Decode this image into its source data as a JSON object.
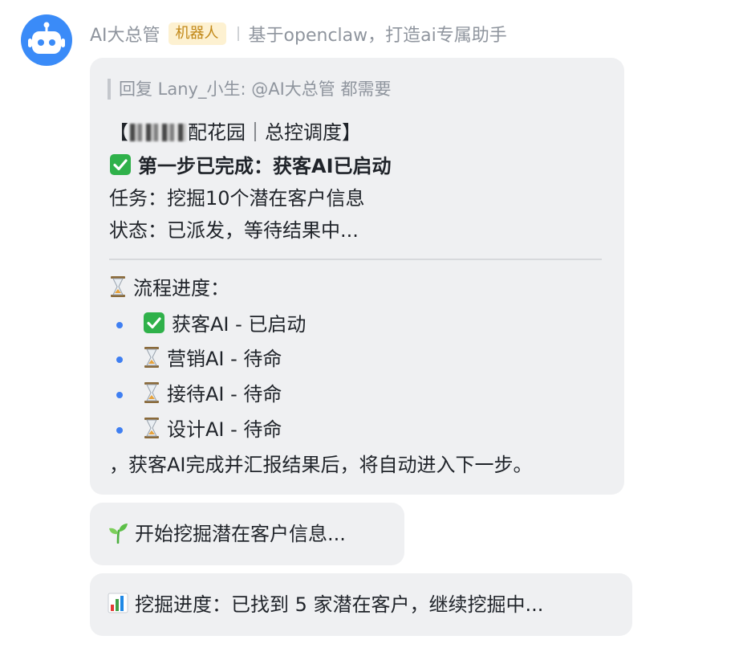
{
  "sender": {
    "name": "AI大总管",
    "tag": "机器人",
    "description": "基于openclaw，打造ai专属助手"
  },
  "main_message": {
    "reply_to": "回复 Lany_小生: @AI大总管 都需要",
    "title_prefix": "【",
    "title_suffix": "配花园｜总控调度】",
    "step_done": "第一步已完成：获客AI已启动",
    "task": "任务：挖掘10个潜在客户信息",
    "status": "状态：已派发，等待结果中...",
    "progress_heading": "流程进度：",
    "progress_items": [
      {
        "icon": "check-icon",
        "label": "获客AI - 已启动"
      },
      {
        "icon": "hourglass-icon",
        "label": "营销AI - 待命"
      },
      {
        "icon": "hourglass-icon",
        "label": "接待AI - 待命"
      },
      {
        "icon": "hourglass-icon",
        "label": "设计AI - 待命"
      }
    ],
    "footer": "，获客AI完成并汇报结果后，将自动进入下一步。"
  },
  "message_2": {
    "icon": "seedling-icon",
    "text": "开始挖掘潜在客户信息..."
  },
  "message_3": {
    "icon": "bar-chart-icon",
    "text": "挖掘进度：已找到 5 家潜在客户，继续挖掘中..."
  },
  "colors": {
    "avatar": "#3a8bf8",
    "bubble": "#eff0f2",
    "tag_bg": "#fdf1d1",
    "tag_text": "#c18716",
    "bullet": "#3f7ff2",
    "check": "#2fb14a"
  }
}
